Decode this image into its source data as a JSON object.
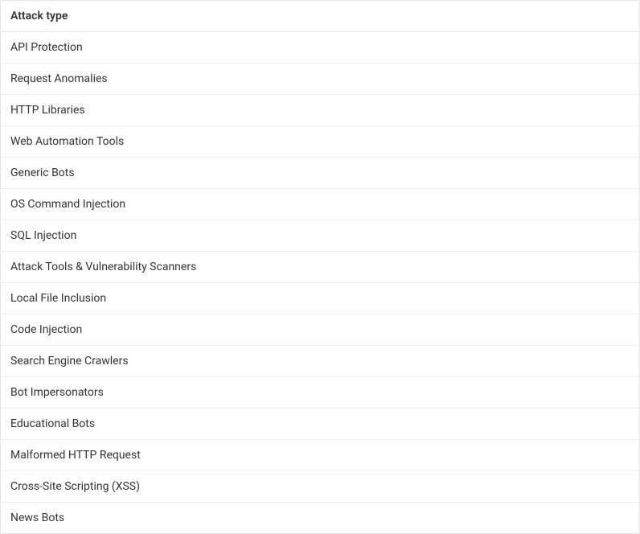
{
  "table": {
    "header": "Attack type",
    "rows": [
      "API Protection",
      "Request Anomalies",
      "HTTP Libraries",
      "Web Automation Tools",
      "Generic Bots",
      "OS Command Injection",
      "SQL Injection",
      "Attack Tools & Vulnerability Scanners",
      "Local File Inclusion",
      "Code Injection",
      "Search Engine Crawlers",
      "Bot Impersonators",
      "Educational Bots",
      "Malformed HTTP Request",
      "Cross-Site Scripting (XSS)",
      "News Bots"
    ]
  }
}
